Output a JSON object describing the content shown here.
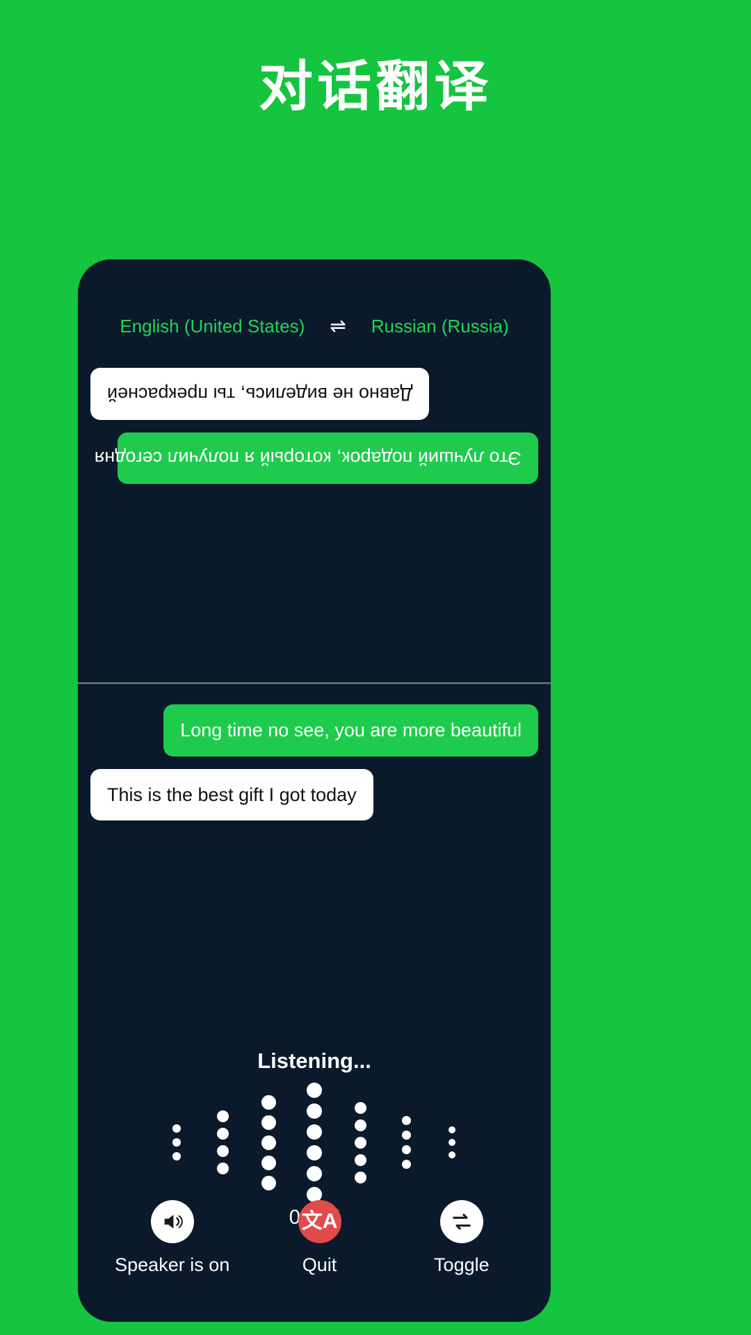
{
  "page": {
    "title": "对话翻译",
    "background_color": "#15c43f",
    "panel_color": "#0a1a2b"
  },
  "language_bar": {
    "source_language": "English (United States)",
    "swap_icon": "swap-arrows-icon",
    "swap_glyph": "⇌",
    "target_language": "Russian (Russia)",
    "text_color": "#1fd654"
  },
  "conversation": {
    "top_half_rotated": true,
    "top_messages": [
      {
        "text": "Это лучший подарок, который я получил сегодня",
        "style": "green",
        "align": "left"
      },
      {
        "text": "Давно не виделись, ты прекрасней",
        "style": "white",
        "align": "right"
      }
    ],
    "bottom_messages": [
      {
        "text": "Long time no see, you are more beautiful",
        "style": "green",
        "align": "right"
      },
      {
        "text": "This is the best gift I got today",
        "style": "white",
        "align": "left"
      }
    ]
  },
  "status": {
    "listening_label": "Listening...",
    "timer": "00:17"
  },
  "waveform": {
    "columns": [
      {
        "dots": 3,
        "size": 12
      },
      {
        "dots": 4,
        "size": 17
      },
      {
        "dots": 5,
        "size": 21
      },
      {
        "dots": 6,
        "size": 22
      },
      {
        "dots": 5,
        "size": 17
      },
      {
        "dots": 4,
        "size": 13
      },
      {
        "dots": 3,
        "size": 10
      }
    ],
    "dot_color": "#ffffff"
  },
  "controls": [
    {
      "label": "Speaker is on",
      "icon": "speaker-on-icon",
      "circle_style": "white",
      "circle_color": "#ffffff"
    },
    {
      "label": "Quit",
      "icon": "translate-icon",
      "glyph": "文A",
      "circle_style": "red",
      "circle_color": "#e14b4b"
    },
    {
      "label": "Toggle",
      "icon": "swap-repeat-icon",
      "circle_style": "white",
      "circle_color": "#ffffff"
    }
  ]
}
